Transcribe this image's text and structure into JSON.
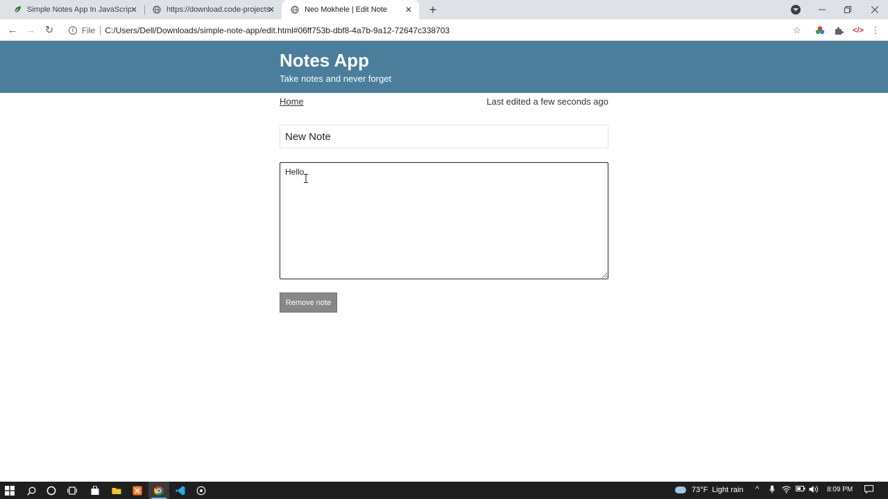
{
  "browser": {
    "tabs": [
      {
        "title": "Simple Notes App In JavaScript W",
        "icon": "leaf-icon",
        "active": false
      },
      {
        "title": "https://download.code-projects.o",
        "icon": "globe-icon",
        "active": false
      },
      {
        "title": "Neo Mokhele | Edit Note",
        "icon": "globe-icon",
        "active": true
      }
    ],
    "address": {
      "scheme_label": "File",
      "url": "C:/Users/Dell/Downloads/simple-note-app/edit.html#06ff753b-dbf8-4a7b-9a12-72647c338703"
    },
    "colors": {
      "tabstrip": "#dee1e6",
      "active_tab": "#ffffff"
    }
  },
  "page": {
    "header": {
      "title": "Notes App",
      "subtitle": "Take notes and never forget",
      "background": "#4a7e9a"
    },
    "nav": {
      "home_label": "Home",
      "last_edited": "Last edited a few seconds ago"
    },
    "note": {
      "title_value": "New Note",
      "body_value": "Hello"
    },
    "actions": {
      "remove_label": "Remove note",
      "remove_color": "#888888"
    }
  },
  "taskbar": {
    "weather": {
      "temperature": "73°F",
      "condition": "Light rain"
    },
    "clock": "8:09 PM",
    "pinned": [
      "windows-start-icon",
      "search-icon",
      "cortana-icon",
      "task-view-icon",
      "store-icon",
      "file-explorer-icon",
      "xampp-icon",
      "chrome-icon",
      "vscode-icon",
      "settings-app-icon"
    ]
  }
}
